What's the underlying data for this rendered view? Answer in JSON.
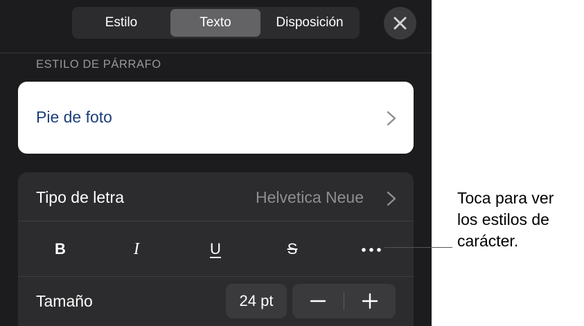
{
  "tabs": [
    {
      "label": "Estilo"
    },
    {
      "label": "Texto",
      "selected": true
    },
    {
      "label": "Disposición"
    }
  ],
  "close_icon": "close-icon",
  "paragraph_style": {
    "section_header": "ESTILO DE PÁRRAFO",
    "current": "Pie de foto",
    "chevron_icon": "chevron-right-icon"
  },
  "font": {
    "label": "Tipo de letra",
    "value": "Helvetica Neue",
    "chevron_icon": "chevron-right-icon"
  },
  "character_styles": {
    "bold": "B",
    "italic": "I",
    "underline": "U",
    "strikethrough": "S",
    "more_icon": "more-icon"
  },
  "size": {
    "label": "Tamaño",
    "value": "24 pt",
    "minus_icon": "minus-icon",
    "plus_icon": "plus-icon"
  },
  "callout": {
    "lines": [
      "Toca para ver",
      "los estilos de",
      "carácter."
    ]
  },
  "colors": {
    "panel_bg": "#1c1c1e",
    "group_bg": "#2c2c2e",
    "selected_tab": "#636366",
    "style_text": "#1c3f7a",
    "secondary_text": "#8e8e93"
  }
}
